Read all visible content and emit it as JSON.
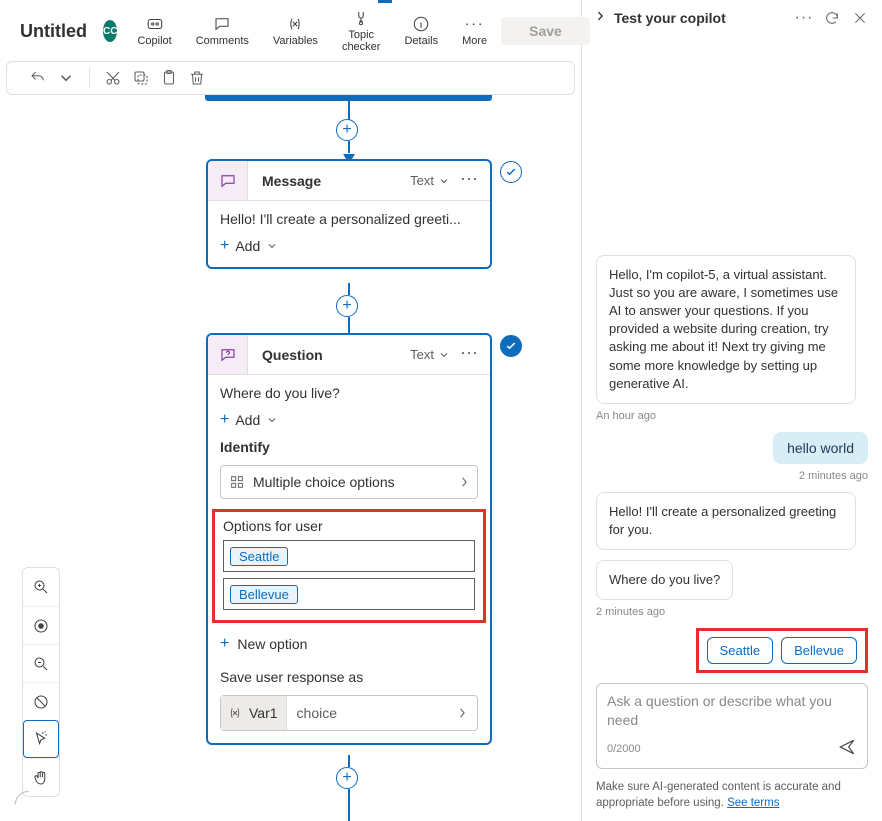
{
  "header": {
    "title": "Untitled",
    "avatar": "CC",
    "tools": {
      "copilot": "Copilot",
      "comments": "Comments",
      "variables": "Variables",
      "topic_checker": "Topic checker",
      "details": "Details",
      "more": "More"
    },
    "save": "Save"
  },
  "canvas": {
    "message_card": {
      "title": "Message",
      "type_label": "Text",
      "content": "Hello! I'll create a personalized greeti...",
      "add": "Add"
    },
    "question_card": {
      "title": "Question",
      "type_label": "Text",
      "prompt": "Where do you live?",
      "add": "Add",
      "identify_label": "Identify",
      "identify_value": "Multiple choice options",
      "options_label": "Options for user",
      "options": [
        "Seattle",
        "Bellevue"
      ],
      "new_option": "New option",
      "save_as_label": "Save user response as",
      "variable_name": "Var1",
      "variable_type": "choice"
    }
  },
  "test_panel": {
    "title": "Test your copilot",
    "messages": {
      "intro": "Hello, I'm copilot-5, a virtual assistant. Just so you are aware, I sometimes use AI to answer your questions. If you provided a website during creation, try asking me about it! Next try giving me some more knowledge by setting up generative AI.",
      "intro_ts": "An hour ago",
      "user1": "hello world",
      "user1_ts": "2 minutes ago",
      "bot2": "Hello! I'll create a personalized greeting for you.",
      "bot3": "Where do you live?",
      "bot3_ts": "2 minutes ago"
    },
    "suggestions": [
      "Seattle",
      "Bellevue"
    ],
    "composer_placeholder": "Ask a question or describe what you need",
    "counter": "0/2000",
    "footnote_text": "Make sure AI-generated content is accurate and appropriate before using. ",
    "footnote_link": "See terms"
  }
}
